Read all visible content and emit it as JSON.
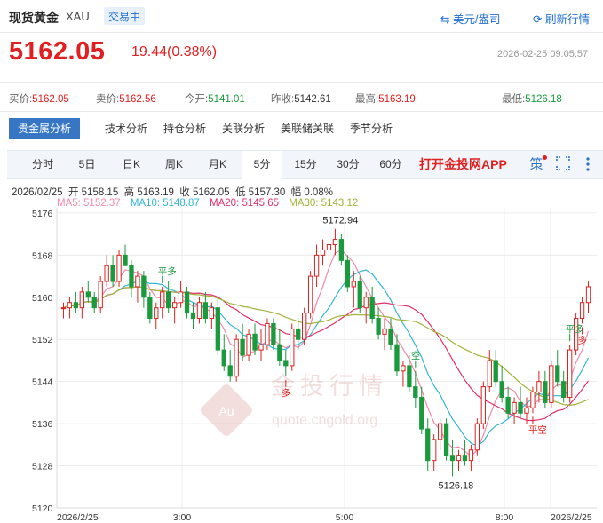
{
  "header": {
    "title": "现货黄金",
    "symbol": "XAU",
    "status_badge": "交易中",
    "currency_button": "美元/盎司",
    "refresh_button": "刷新行情"
  },
  "price": {
    "last": "5162.05",
    "change": "19.44(0.38%)",
    "datetime": "2026-02-25 09:05:57"
  },
  "quotes": [
    {
      "label": "买价:",
      "value": "5162.05",
      "trend": "up"
    },
    {
      "label": "卖价:",
      "value": "5162.56",
      "trend": "up"
    },
    {
      "label": "今开:",
      "value": "5141.01",
      "trend": "dn"
    },
    {
      "label": "昨收:",
      "value": "5142.61",
      "trend": "flat"
    },
    {
      "label": "最高:",
      "value": "5163.19",
      "trend": "up"
    },
    {
      "label": "最低:",
      "value": "5126.18",
      "trend": "dn"
    }
  ],
  "analysis_tabs": [
    "贵金属分析",
    "技术分析",
    "持仓分析",
    "关联分析",
    "美联储关联",
    "季节分析"
  ],
  "period_tabs": [
    "分时",
    "5日",
    "日K",
    "周K",
    "月K",
    "5分",
    "15分",
    "30分",
    "60分"
  ],
  "active_period": "5分",
  "open_app_label": "打开金投网APP",
  "toolbar_icons": [
    "strategy-icon",
    "fullscreen-icon",
    "more-icon"
  ],
  "strategy_label": "策",
  "ohlc": {
    "date": "2026/02/25",
    "open_label": "开",
    "open": "5158.15",
    "high_label": "高",
    "high": "5163.19",
    "close_label": "收",
    "close": "5162.05",
    "low_label": "低",
    "low": "5157.30",
    "amp_label": "幅",
    "amp": "0.08%"
  },
  "ma": [
    {
      "label": "MA5: 5152.37",
      "color": "#f08aa8"
    },
    {
      "label": "MA10: 5148.87",
      "color": "#35b6d6"
    },
    {
      "label": "MA20: 5145.65",
      "color": "#e0306a"
    },
    {
      "label": "MA30: 5143.12",
      "color": "#a2b23a"
    }
  ],
  "watermark": {
    "brand": "金投行情",
    "url": "quote.cngold.org",
    "logo_text": "Au"
  },
  "chart_data": {
    "type": "candlestick",
    "ylim": [
      5120,
      5177
    ],
    "y_ticks": [
      5176,
      5168,
      5160,
      5152,
      5144,
      5136,
      5128,
      5120
    ],
    "x_ticks": [
      "2026/2/25",
      "3:00",
      "5:00",
      "8:00",
      "2026/2/25"
    ],
    "up_color": "#e02020",
    "down_color": "#1a9a3c",
    "annotations": [
      {
        "text": "5172.94",
        "kind": "high"
      },
      {
        "text": "5126.18",
        "kind": "low"
      },
      {
        "text": "平多",
        "kind": "signal"
      },
      {
        "text": "多",
        "kind": "signal"
      },
      {
        "text": "空",
        "kind": "signal"
      },
      {
        "text": "平空",
        "kind": "signal"
      },
      {
        "text": "平多",
        "kind": "signal"
      },
      {
        "text": "多",
        "kind": "signal"
      }
    ],
    "candles": [
      [
        5158,
        5159,
        5156,
        5158
      ],
      [
        5158,
        5160,
        5156,
        5159
      ],
      [
        5159,
        5161,
        5157,
        5158
      ],
      [
        5158,
        5162,
        5156,
        5161
      ],
      [
        5161,
        5163,
        5159,
        5160
      ],
      [
        5160,
        5161,
        5157,
        5158
      ],
      [
        5158,
        5164,
        5157,
        5163
      ],
      [
        5163,
        5168,
        5162,
        5166
      ],
      [
        5166,
        5168,
        5162,
        5163
      ],
      [
        5163,
        5169,
        5162,
        5168
      ],
      [
        5168,
        5170,
        5166,
        5166
      ],
      [
        5166,
        5167,
        5160,
        5162
      ],
      [
        5162,
        5165,
        5159,
        5164
      ],
      [
        5164,
        5165,
        5158,
        5160
      ],
      [
        5160,
        5161,
        5155,
        5156
      ],
      [
        5156,
        5159,
        5154,
        5158
      ],
      [
        5158,
        5162,
        5156,
        5161
      ],
      [
        5161,
        5163,
        5157,
        5158
      ],
      [
        5158,
        5160,
        5155,
        5159
      ],
      [
        5159,
        5163,
        5158,
        5161
      ],
      [
        5161,
        5162,
        5156,
        5157
      ],
      [
        5157,
        5159,
        5154,
        5156
      ],
      [
        5156,
        5160,
        5155,
        5159
      ],
      [
        5159,
        5161,
        5155,
        5156
      ],
      [
        5156,
        5159,
        5154,
        5158
      ],
      [
        5158,
        5160,
        5149,
        5150
      ],
      [
        5150,
        5153,
        5146,
        5147
      ],
      [
        5147,
        5150,
        5144,
        5145
      ],
      [
        5145,
        5153,
        5144,
        5152
      ],
      [
        5152,
        5155,
        5148,
        5149
      ],
      [
        5149,
        5154,
        5148,
        5153
      ],
      [
        5153,
        5155,
        5149,
        5150
      ],
      [
        5150,
        5154,
        5148,
        5151
      ],
      [
        5151,
        5156,
        5150,
        5155
      ],
      [
        5155,
        5156,
        5150,
        5151
      ],
      [
        5151,
        5154,
        5147,
        5148
      ],
      [
        5148,
        5150,
        5145,
        5147
      ],
      [
        5147,
        5155,
        5146,
        5154
      ],
      [
        5154,
        5156,
        5150,
        5152
      ],
      [
        5152,
        5158,
        5151,
        5157
      ],
      [
        5157,
        5165,
        5156,
        5164
      ],
      [
        5164,
        5170,
        5162,
        5168
      ],
      [
        5168,
        5171,
        5166,
        5169
      ],
      [
        5169,
        5172,
        5167,
        5170
      ],
      [
        5170,
        5173,
        5168,
        5171
      ],
      [
        5171,
        5172,
        5166,
        5167
      ],
      [
        5167,
        5168,
        5161,
        5162
      ],
      [
        5162,
        5165,
        5158,
        5163
      ],
      [
        5163,
        5164,
        5157,
        5158
      ],
      [
        5158,
        5161,
        5155,
        5160
      ],
      [
        5160,
        5162,
        5155,
        5156
      ],
      [
        5156,
        5158,
        5152,
        5153
      ],
      [
        5153,
        5156,
        5150,
        5154
      ],
      [
        5154,
        5156,
        5150,
        5151
      ],
      [
        5151,
        5153,
        5145,
        5146
      ],
      [
        5146,
        5148,
        5143,
        5147
      ],
      [
        5147,
        5149,
        5142,
        5143
      ],
      [
        5143,
        5146,
        5139,
        5141
      ],
      [
        5141,
        5143,
        5134,
        5135
      ],
      [
        5135,
        5137,
        5127,
        5129
      ],
      [
        5129,
        5134,
        5127,
        5133
      ],
      [
        5133,
        5137,
        5131,
        5136
      ],
      [
        5136,
        5137,
        5129,
        5130
      ],
      [
        5130,
        5133,
        5126,
        5129
      ],
      [
        5129,
        5131,
        5127,
        5130
      ],
      [
        5130,
        5133,
        5128,
        5129
      ],
      [
        5129,
        5132,
        5127,
        5131
      ],
      [
        5131,
        5137,
        5130,
        5136
      ],
      [
        5136,
        5144,
        5135,
        5143
      ],
      [
        5143,
        5150,
        5142,
        5148
      ],
      [
        5148,
        5150,
        5143,
        5144
      ],
      [
        5144,
        5147,
        5140,
        5141
      ],
      [
        5141,
        5143,
        5137,
        5138
      ],
      [
        5138,
        5141,
        5136,
        5140
      ],
      [
        5140,
        5143,
        5137,
        5138
      ],
      [
        5138,
        5141,
        5136,
        5139
      ],
      [
        5139,
        5143,
        5138,
        5142
      ],
      [
        5142,
        5146,
        5140,
        5144
      ],
      [
        5144,
        5146,
        5139,
        5140
      ],
      [
        5140,
        5148,
        5139,
        5147
      ],
      [
        5147,
        5150,
        5143,
        5144
      ],
      [
        5144,
        5146,
        5140,
        5141
      ],
      [
        5141,
        5151,
        5140,
        5150
      ],
      [
        5150,
        5157,
        5149,
        5156
      ],
      [
        5156,
        5160,
        5155,
        5159
      ],
      [
        5159,
        5163,
        5157,
        5162
      ]
    ]
  }
}
